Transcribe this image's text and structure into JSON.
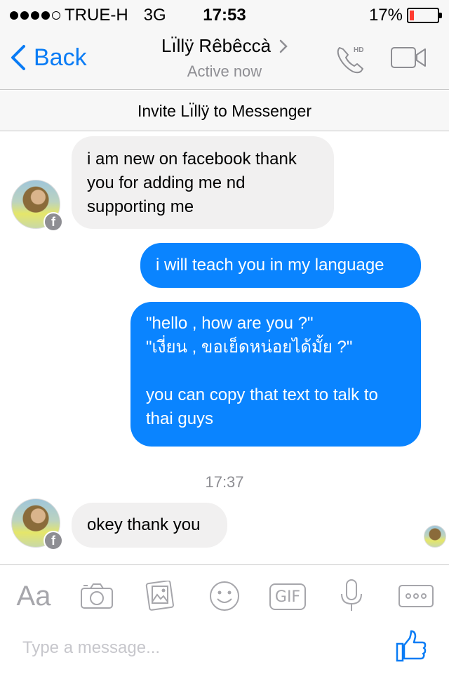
{
  "status_bar": {
    "carrier": "TRUE-H",
    "network": "3G",
    "time": "17:53",
    "battery": "17%",
    "battery_level": 0.17,
    "signal_bars_filled": 4,
    "signal_bars_total": 5
  },
  "nav": {
    "back_label": "Back",
    "contact_name": "Lı̈llÿ Rêbêccà",
    "status": "Active now",
    "accent_color": "#0a7cf5"
  },
  "invite": {
    "label": "Invite Lı̈llÿ to Messenger"
  },
  "messages": [
    {
      "direction": "in",
      "text": "i am new on facebook thank\nyou for adding me nd\nsupporting me"
    },
    {
      "direction": "out",
      "text": "i will teach you in my language"
    },
    {
      "direction": "out",
      "text": "\"hello , how are you ?\"\n\"เงี่ยน , ขอเย็ดหน่อยได้มั้ย ?\"\n\nyou can copy that text to talk to\nthai guys"
    },
    {
      "direction": "in",
      "text": "okey thank you"
    }
  ],
  "timestamp": "17:37",
  "composer": {
    "font_button": "Aa",
    "gif_label": "GIF",
    "placeholder": "Type a message..."
  },
  "colors": {
    "outgoing_bubble": "#0a84ff",
    "incoming_bubble": "#f1f0f0",
    "battery_low": "#ff3b30"
  }
}
